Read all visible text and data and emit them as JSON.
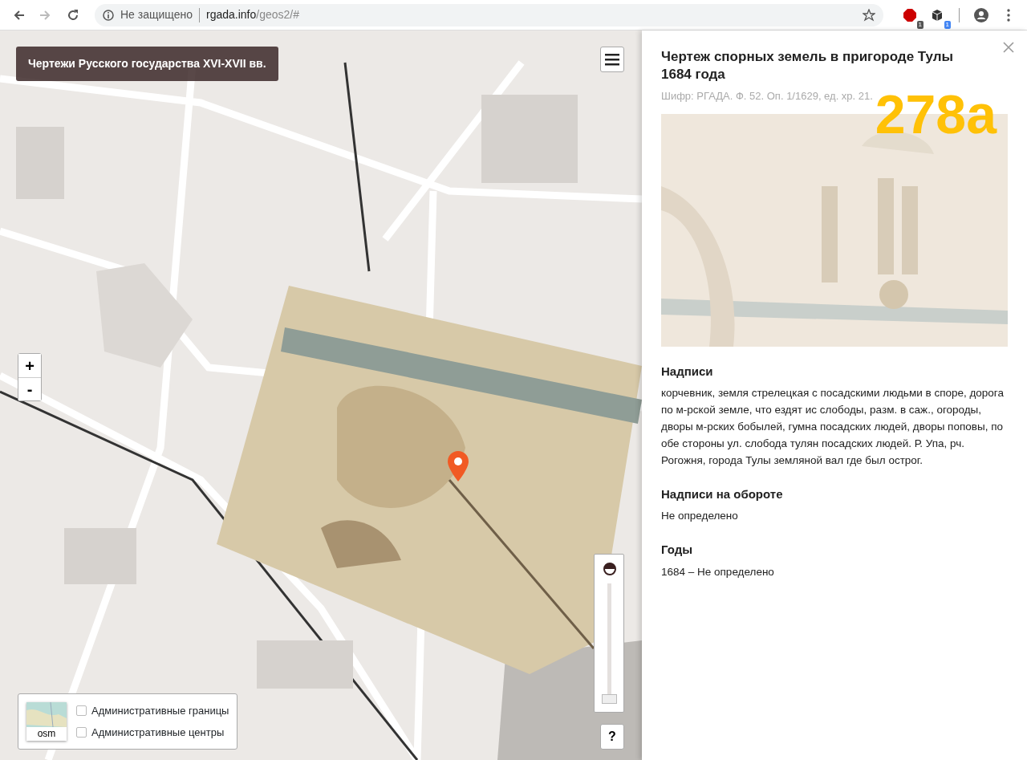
{
  "browser": {
    "nav_buttons": [
      {
        "kind": "back",
        "disabled": false
      },
      {
        "kind": "forward",
        "disabled": true
      },
      {
        "kind": "reload",
        "disabled": false
      }
    ],
    "security": "Не защищено",
    "url_host": "rgada.info",
    "url_path": "/geos2/#",
    "extensions": [
      {
        "kind": "stop",
        "badge": "1",
        "color": "#555555"
      },
      {
        "kind": "cube",
        "badge": "1",
        "color": "#4285f4"
      }
    ]
  },
  "map": {
    "title": "Чертежи Русского государства XVI-XVII вв.",
    "zoom_buttons": [
      "+",
      "-"
    ],
    "opacity_slider": {
      "level": 0
    },
    "help_button": "?",
    "layers": {
      "base_label": "osm",
      "overlays": [
        {
          "label": "Административные границы",
          "checked": false
        },
        {
          "label": "Административные центры",
          "checked": false
        }
      ]
    }
  },
  "panel": {
    "title": "Чертеж спорных земель в пригороде Тулы 1684 года",
    "code": "Шифр: РГАДА. Ф. 52. Оп. 1/1629, ед. хр. 21.",
    "number": "278а",
    "sections": [
      {
        "heading": "Надписи",
        "text": "корчевник, земля стрелецкая с посадскими людьми в споре, дорога по м-рской земле, что ездят ис слободы, разм. в саж., огороды, дворы м-рских бобылей, гумна посадских людей, дворы поповы, по обе стороны ул. слобода тулян посадских людей. Р. Упа, рч. Рогожня, города Тулы земляной вал где был острог."
      },
      {
        "heading": "Надписи на обороте",
        "text": "Не определено"
      },
      {
        "heading": "Годы",
        "text": "1684 – Не определено"
      }
    ]
  }
}
